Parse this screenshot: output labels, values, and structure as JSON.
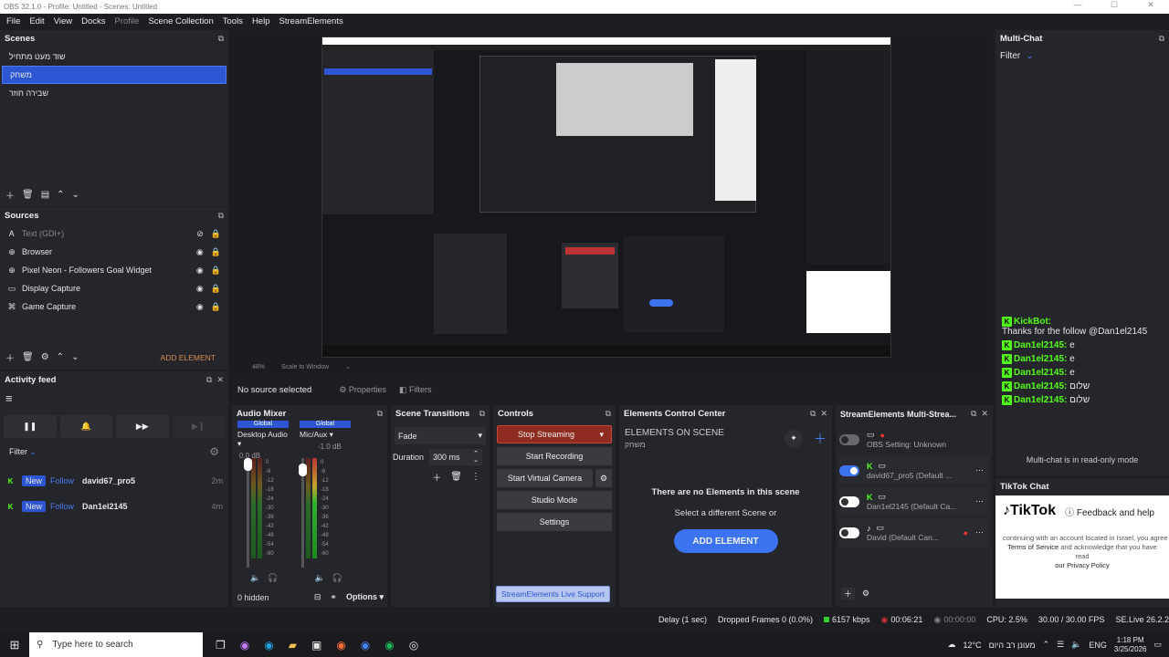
{
  "titlebar": {
    "title": "OBS 32.1.0 - Profile: Untitled - Scenes: Untitled"
  },
  "menu": [
    "File",
    "Edit",
    "View",
    "Docks",
    "Profile",
    "Scene Collection",
    "Tools",
    "Help",
    "StreamElements"
  ],
  "scenes": {
    "title": "Scenes",
    "items": [
      "שוד מעט מתחיל",
      "משחק",
      "שבירה חוזר"
    ],
    "selected_index": 1
  },
  "sources": {
    "title": "Sources",
    "items": [
      {
        "name": "Text (GDI+)",
        "icon": "text-icon",
        "dim": true
      },
      {
        "name": "Browser",
        "icon": "globe-icon",
        "dim": false
      },
      {
        "name": "Pixel Neon - Followers Goal Widget",
        "icon": "globe-icon",
        "dim": false
      },
      {
        "name": "Display Capture",
        "icon": "monitor-icon",
        "dim": false
      },
      {
        "name": "Game Capture",
        "icon": "gamepad-icon",
        "dim": false
      }
    ],
    "add_element": "ADD ELEMENT"
  },
  "activity": {
    "title": "Activity feed",
    "filter": "Filter",
    "items": [
      {
        "badge": "New",
        "type": "Follow",
        "user": "david67_pro5",
        "time": "2m"
      },
      {
        "badge": "New",
        "type": "Follow",
        "user": "Dan1el2145",
        "time": "4m"
      }
    ]
  },
  "preview": {
    "zoom": "48%",
    "scale": "Scale to Window"
  },
  "source_bar": {
    "label": "No source selected",
    "properties": "Properties",
    "filters": "Filters"
  },
  "audio": {
    "title": "Audio Mixer",
    "channels": [
      {
        "name": "Desktop Audio",
        "db": "0.0 dB",
        "tag": "Global"
      },
      {
        "name": "Mic/Aux",
        "db": "-1.0 dB",
        "tag": "Global"
      }
    ],
    "scale": [
      "0",
      "-6",
      "-12",
      "-18",
      "-24",
      "-30",
      "-36",
      "-42",
      "-48",
      "-54",
      "-60"
    ],
    "hidden": "0 hidden",
    "options": "Options"
  },
  "transitions": {
    "title": "Scene Transitions",
    "type": "Fade",
    "duration_label": "Duration",
    "duration": "300 ms"
  },
  "controls": {
    "title": "Controls",
    "stream": "Stop Streaming",
    "record": "Start Recording",
    "vcam": "Start Virtual Camera",
    "studio": "Studio Mode",
    "settings": "Settings",
    "support": "StreamElements Live Support"
  },
  "ecc": {
    "title": "Elements Control Center",
    "on_scene": "ELEMENTS ON SCENE",
    "scene_name": "משחק",
    "empty": "There are no Elements in this scene",
    "hint": "Select a different Scene or",
    "add": "ADD ELEMENT"
  },
  "multistream": {
    "title": "StreamElements Multi-Strea...",
    "rows": [
      {
        "label": "OBS Setting: Unknown",
        "on": false
      },
      {
        "label": "david67_pro5 (Default ...",
        "on": true
      },
      {
        "label": "Dan1el2145 (Default Ca...",
        "on": false
      },
      {
        "label": "David (Default Can...",
        "on": false
      }
    ]
  },
  "multichat": {
    "title": "Multi-Chat",
    "filter": "Filter",
    "messages": [
      {
        "user": "KickBot:",
        "text": "Thanks for the follow @Dan1el2145"
      },
      {
        "user": "Dan1el2145:",
        "text": "e"
      },
      {
        "user": "Dan1el2145:",
        "text": "e"
      },
      {
        "user": "Dan1el2145:",
        "text": "e"
      },
      {
        "user": "Dan1el2145:",
        "text": "שלום"
      },
      {
        "user": "Dan1el2145:",
        "text": "שלום"
      }
    ],
    "readonly": "Multi-chat is in read-only mode"
  },
  "tiktok": {
    "title": "TikTok Chat",
    "logo": "TikTok",
    "feedback": "Feedback and help",
    "line1": "continuing with an account located in Israel, you agree",
    "line2a": "Terms of Service",
    "line2b": "and acknowledge that you have read",
    "line3": "our Privacy Policy"
  },
  "status": {
    "delay": "Delay (1 sec)",
    "dropped": "Dropped Frames 0 (0.0%)",
    "kbps": "6157 kbps",
    "stream_time": "00:06:21",
    "rec_time": "00:00:00",
    "cpu": "CPU: 2.5%",
    "fps": "30.00 / 30.00 FPS",
    "selive": "SE.Live 26.2.2"
  },
  "taskbar": {
    "search": "Type here to search",
    "weather": "12°C",
    "weather_text": "מעונן רב היום",
    "lang": "ENG",
    "time": "1:18 PM",
    "date": "3/25/2026"
  }
}
